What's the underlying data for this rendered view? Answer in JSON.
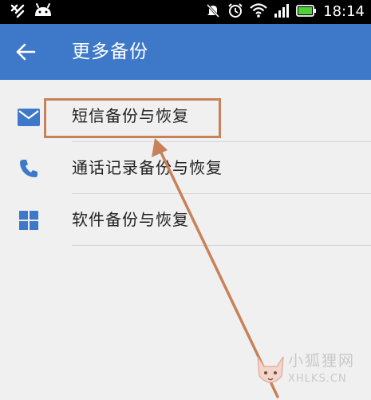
{
  "status_bar": {
    "time": "18:14",
    "icons_left": [
      "usb-debug-icon",
      "android-icon"
    ],
    "icons_right": [
      "mute-icon",
      "alarm-icon",
      "wifi-icon",
      "signal-icon",
      "battery-icon"
    ]
  },
  "app_bar": {
    "title": "更多备份",
    "back_icon": "back-arrow-icon",
    "color": "#3e79c9"
  },
  "menu": {
    "items": [
      {
        "label": "短信备份与恢复",
        "icon": "mail-icon",
        "highlighted": true
      },
      {
        "label": "通话记录备份与恢复",
        "icon": "phone-icon",
        "highlighted": false
      },
      {
        "label": "软件备份与恢复",
        "icon": "grid-icon",
        "highlighted": false
      }
    ]
  },
  "annotation": {
    "color": "#c8825a"
  },
  "watermark": {
    "title": "小狐狸网",
    "domain": "XHLKS.CN"
  }
}
